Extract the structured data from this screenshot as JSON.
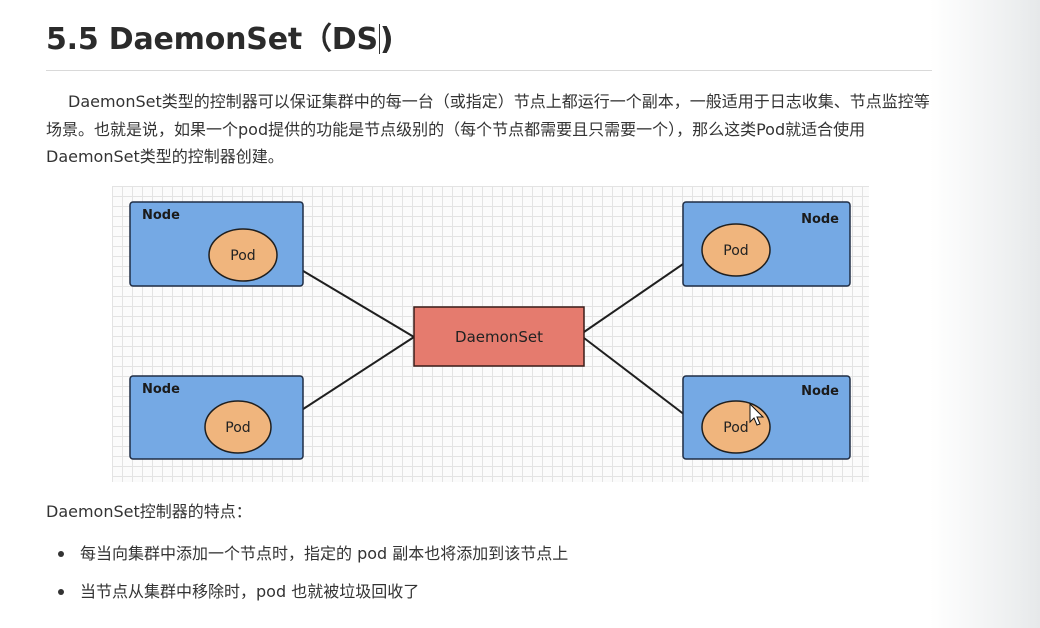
{
  "heading": {
    "text": "5.5 DaemonSet（DS"
  },
  "heading_end": ")",
  "intro": "DaemonSet类型的控制器可以保证集群中的每一台（或指定）节点上都运行一个副本，一般适用于日志收集、节点监控等场景。也就是说，如果一个pod提供的功能是节点级别的（每个节点都需要且只需要一个），那么这类Pod就适合使用DaemonSet类型的控制器创建。",
  "diagram": {
    "center_label": "DaemonSet",
    "nodes": [
      {
        "label": "Node",
        "pod": "Pod"
      },
      {
        "label": "Node",
        "pod": "Pod"
      },
      {
        "label": "Node",
        "pod": "Pod"
      },
      {
        "label": "Node",
        "pod": "Pod"
      }
    ],
    "colors": {
      "node_fill": "#75a9e4",
      "pod_fill": "#f0b57d",
      "daemonset_fill": "#e57b6e",
      "edge": "#1f1f1f"
    }
  },
  "features_title": "DaemonSet控制器的特点：",
  "features": [
    "每当向集群中添加一个节点时，指定的 pod 副本也将添加到该节点上",
    "当节点从集群中移除时，pod 也就被垃圾回收了"
  ]
}
